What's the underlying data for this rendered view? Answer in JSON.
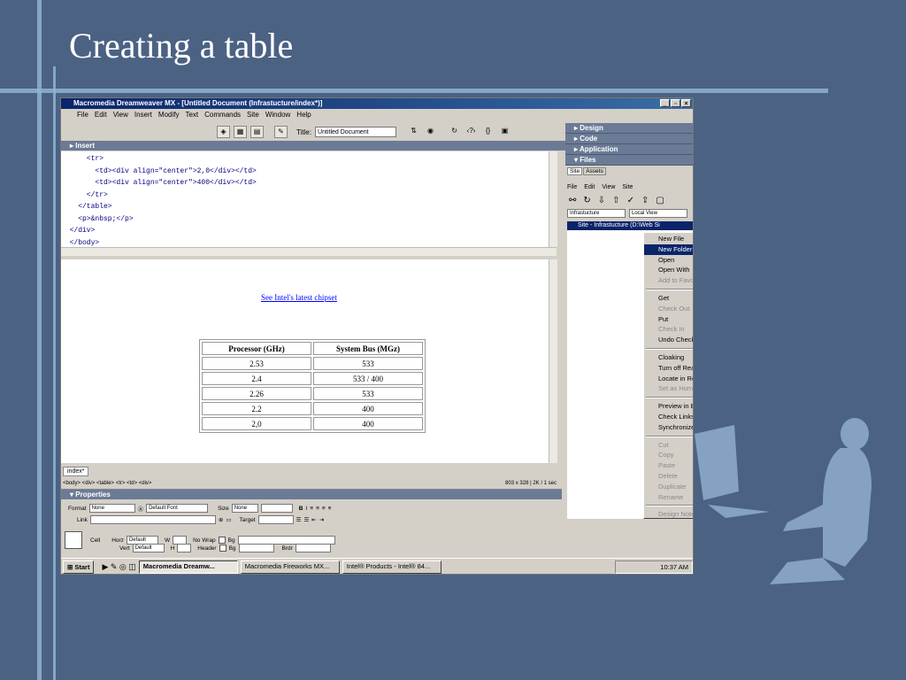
{
  "slide": {
    "title": "Creating a table"
  },
  "window": {
    "title": "Macromedia Dreamweaver MX - [Untitled Document (Infrastucture/index*)]",
    "menu": [
      "File",
      "Edit",
      "View",
      "Insert",
      "Modify",
      "Text",
      "Commands",
      "Site",
      "Window",
      "Help"
    ],
    "title_label": "Title:",
    "title_value": "Untitled Document",
    "insert_label": "Insert"
  },
  "code_lines": [
    "      <tr>",
    "        <td><div align=\"center\">2,0</div></td>",
    "        <td><div align=\"center\">400</div></td>",
    "      </tr>",
    "    </table>",
    "    <p>&nbsp;</p>",
    "  </div>",
    "  </body>"
  ],
  "design": {
    "link_text": "See Intel's latest chipset",
    "table": {
      "headers": [
        "Processor (GHz)",
        "System Bus (MGz)"
      ],
      "rows": [
        [
          "2.53",
          "533"
        ],
        [
          "2.4",
          "533 / 400"
        ],
        [
          "2.26",
          "533"
        ],
        [
          "2.2",
          "400"
        ],
        [
          "2,0",
          "400"
        ]
      ]
    }
  },
  "doc_tab": "index*",
  "status": {
    "tags": "<body> <div> <table> <tr> <td> <div>",
    "size": "803 x 328",
    "weight": "2K / 1 sec"
  },
  "properties": {
    "title": "Properties",
    "format_label": "Format",
    "format_value": "None",
    "font_value": "Default Font",
    "size_label": "Size",
    "size_value": "None",
    "link_label": "Link",
    "target_label": "Target",
    "cell_label": "Cell",
    "horz_label": "Horz",
    "horz_value": "Default",
    "vert_label": "Vert",
    "vert_value": "Default",
    "w_label": "W",
    "h_label": "H",
    "nowrap_label": "No Wrap",
    "header_label": "Header",
    "bg_label": "Bg",
    "brdr_label": "Brdr"
  },
  "panels": {
    "design": "Design",
    "code": "Code",
    "application": "Application",
    "files": "Files",
    "tabs": [
      "Site",
      "Assets"
    ],
    "menus": [
      "File",
      "Edit",
      "View",
      "Site"
    ],
    "site_select": "Infrastucture",
    "view_select": "Local View",
    "tree_item": "Site - Infrastucture (D:\\Web Si"
  },
  "context_menu": [
    {
      "label": "New File",
      "disabled": false
    },
    {
      "label": "New Folder",
      "highlight": true
    },
    {
      "label": "Open",
      "disabled": false
    },
    {
      "label": "Open With",
      "submenu": true
    },
    {
      "label": "Add to Favorites",
      "disabled": true
    },
    {
      "sep": true
    },
    {
      "label": "Get"
    },
    {
      "label": "Check Out",
      "disabled": true
    },
    {
      "label": "Put"
    },
    {
      "label": "Check In",
      "disabled": true
    },
    {
      "label": "Undo Check Out"
    },
    {
      "sep": true
    },
    {
      "label": "Cloaking",
      "submenu": true
    },
    {
      "label": "Turn off Read Only"
    },
    {
      "label": "Locate in Remote Site"
    },
    {
      "label": "Set as Home Page",
      "disabled": true
    },
    {
      "sep": true
    },
    {
      "label": "Preview in Browser",
      "submenu": true
    },
    {
      "label": "Check Links",
      "submenu": true
    },
    {
      "label": "Synchronize..."
    },
    {
      "sep": true
    },
    {
      "label": "Cut",
      "disabled": true
    },
    {
      "label": "Copy",
      "disabled": true
    },
    {
      "label": "Paste",
      "disabled": true
    },
    {
      "label": "Delete",
      "disabled": true
    },
    {
      "label": "Duplicate",
      "disabled": true
    },
    {
      "label": "Rename",
      "disabled": true
    },
    {
      "sep": true
    },
    {
      "label": "Design Notes...",
      "disabled": true
    }
  ],
  "taskbar": {
    "start": "Start",
    "tasks": [
      "Macromedia Dreamw...",
      "Macromedia Fireworks MX...",
      "Intel® Products - Intel® 84..."
    ],
    "clock": "10:37 AM"
  }
}
